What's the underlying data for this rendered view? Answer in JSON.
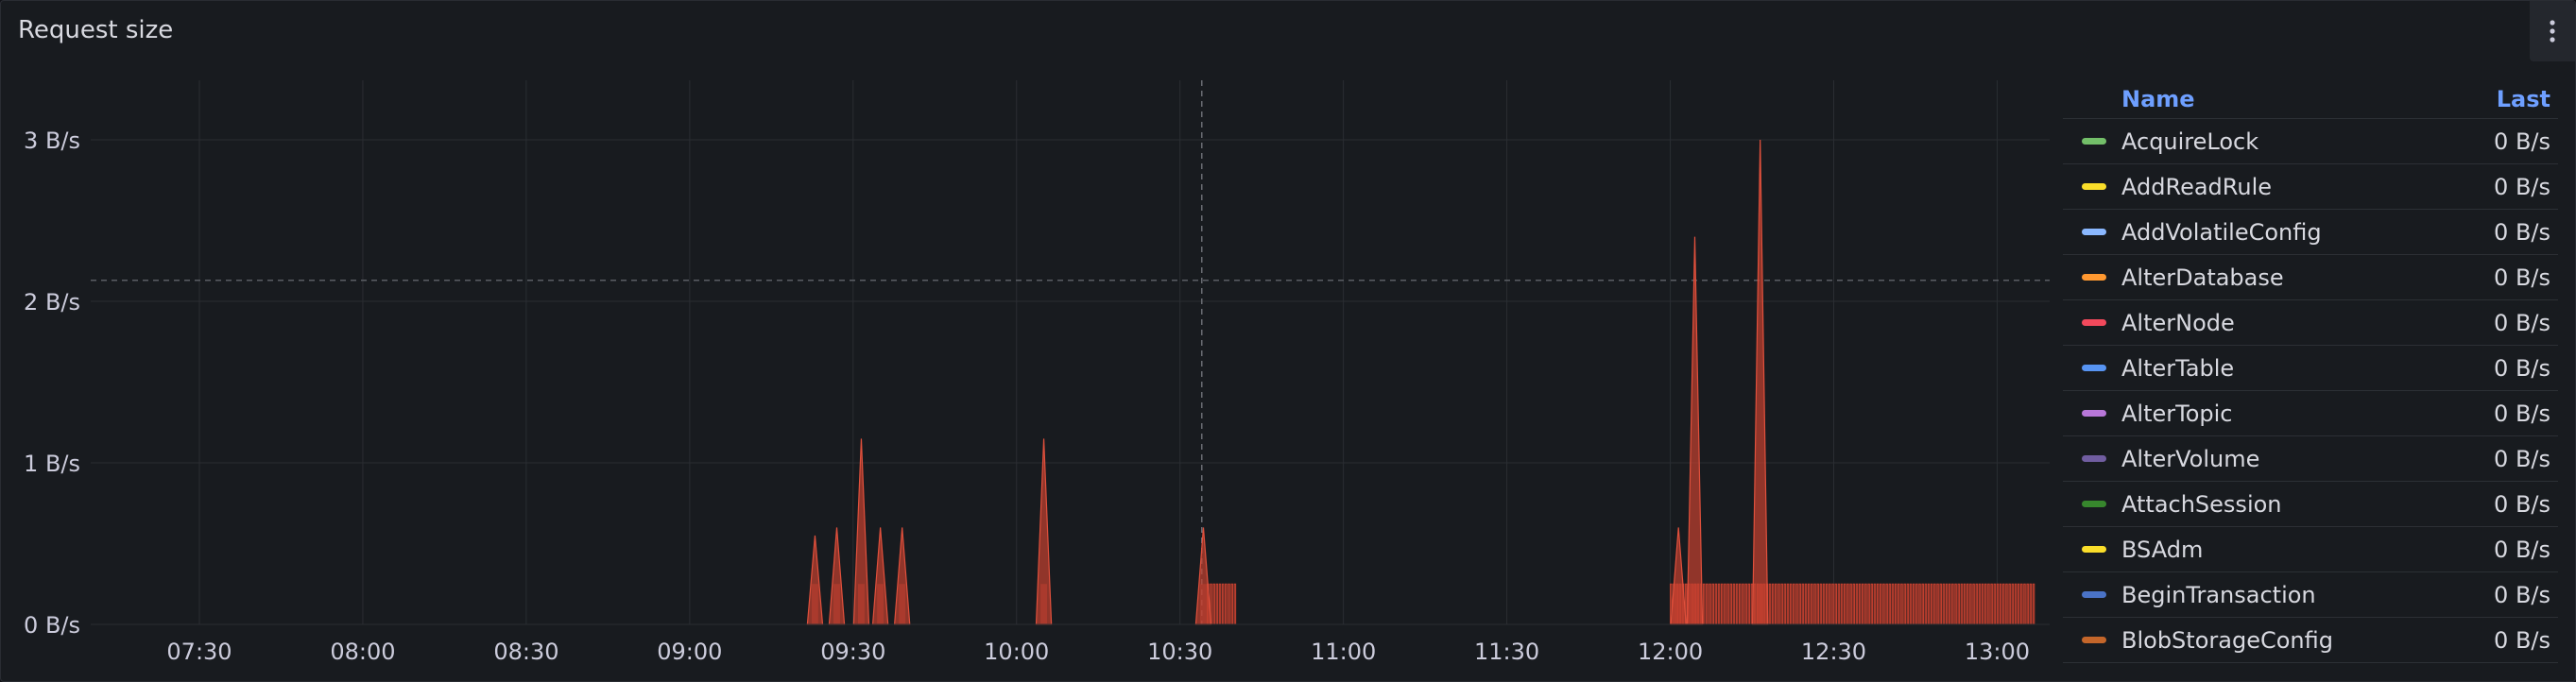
{
  "panel": {
    "title": "Request size"
  },
  "chart_data": {
    "type": "area",
    "title": "Request size",
    "y_ticks": [
      "0 B/s",
      "1 B/s",
      "2 B/s",
      "3 B/s"
    ],
    "ylim": [
      0,
      3.3
    ],
    "x_ticks": [
      "07:30",
      "08:00",
      "08:30",
      "09:00",
      "09:30",
      "10:00",
      "10:30",
      "11:00",
      "11:30",
      "12:00",
      "12:30",
      "13:00"
    ],
    "xlim_minutes": [
      427,
      792
    ],
    "threshold": 2.13,
    "crosshair_minutes": 634,
    "series_color": "#c4402f",
    "spikes": [
      {
        "t": 563,
        "v": 0.55
      },
      {
        "t": 567,
        "v": 0.6
      },
      {
        "t": 571.5,
        "v": 1.15
      },
      {
        "t": 575,
        "v": 0.6
      },
      {
        "t": 579,
        "v": 0.6
      },
      {
        "t": 605,
        "v": 1.15
      },
      {
        "t": 634.3,
        "v": 0.6
      },
      {
        "t": 721.5,
        "v": 0.6
      },
      {
        "t": 724.5,
        "v": 2.4
      },
      {
        "t": 736.5,
        "v": 3.0
      }
    ],
    "baseline_ranges": [
      {
        "from": 635,
        "to": 640,
        "v": 0.25
      },
      {
        "from": 720,
        "to": 787,
        "v": 0.25
      }
    ],
    "grid": true
  },
  "legend": {
    "headers": {
      "name": "Name",
      "last": "Last"
    },
    "items": [
      {
        "name": "AcquireLock",
        "last": "0 B/s",
        "color": "#73bf69"
      },
      {
        "name": "AddReadRule",
        "last": "0 B/s",
        "color": "#fade2a"
      },
      {
        "name": "AddVolatileConfig",
        "last": "0 B/s",
        "color": "#8ab8ff"
      },
      {
        "name": "AlterDatabase",
        "last": "0 B/s",
        "color": "#ff9830"
      },
      {
        "name": "AlterNode",
        "last": "0 B/s",
        "color": "#f2495c"
      },
      {
        "name": "AlterTable",
        "last": "0 B/s",
        "color": "#5794f2"
      },
      {
        "name": "AlterTopic",
        "last": "0 B/s",
        "color": "#b877d9"
      },
      {
        "name": "AlterVolume",
        "last": "0 B/s",
        "color": "#705da0"
      },
      {
        "name": "AttachSession",
        "last": "0 B/s",
        "color": "#37872d"
      },
      {
        "name": "BSAdm",
        "last": "0 B/s",
        "color": "#fade2a"
      },
      {
        "name": "BeginTransaction",
        "last": "0 B/s",
        "color": "#4a73c7"
      },
      {
        "name": "BlobStorageConfig",
        "last": "0 B/s",
        "color": "#c4662a"
      }
    ]
  }
}
